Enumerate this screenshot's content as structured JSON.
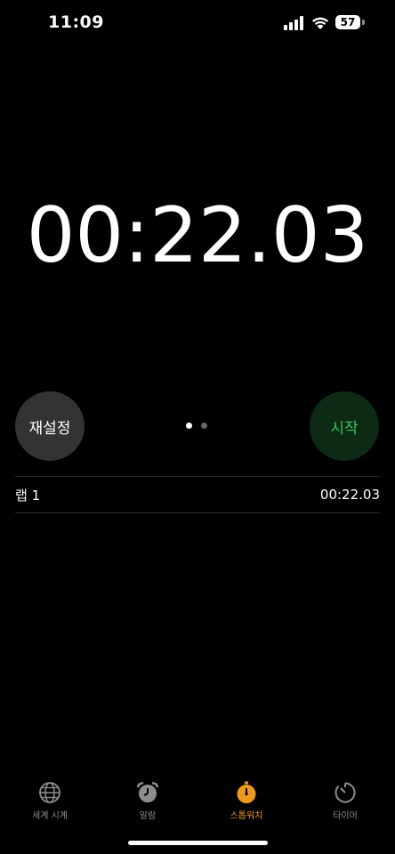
{
  "status_bar": {
    "time": "11:09",
    "battery": "57"
  },
  "stopwatch": {
    "time": "00:22.03"
  },
  "controls": {
    "reset_label": "재설정",
    "start_label": "시작"
  },
  "laps": [
    {
      "label": "랩 1",
      "time": "00:22.03"
    }
  ],
  "tabs": [
    {
      "label": "세계 시계",
      "icon": "globe-icon"
    },
    {
      "label": "알람",
      "icon": "alarm-clock-icon"
    },
    {
      "label": "스톱워치",
      "icon": "stopwatch-icon",
      "active": true
    },
    {
      "label": "타이머",
      "icon": "timer-icon"
    }
  ],
  "colors": {
    "accent": "#f09a1a",
    "start_text": "#33c75a",
    "start_bg": "#0d2a14",
    "reset_bg": "#333333"
  }
}
